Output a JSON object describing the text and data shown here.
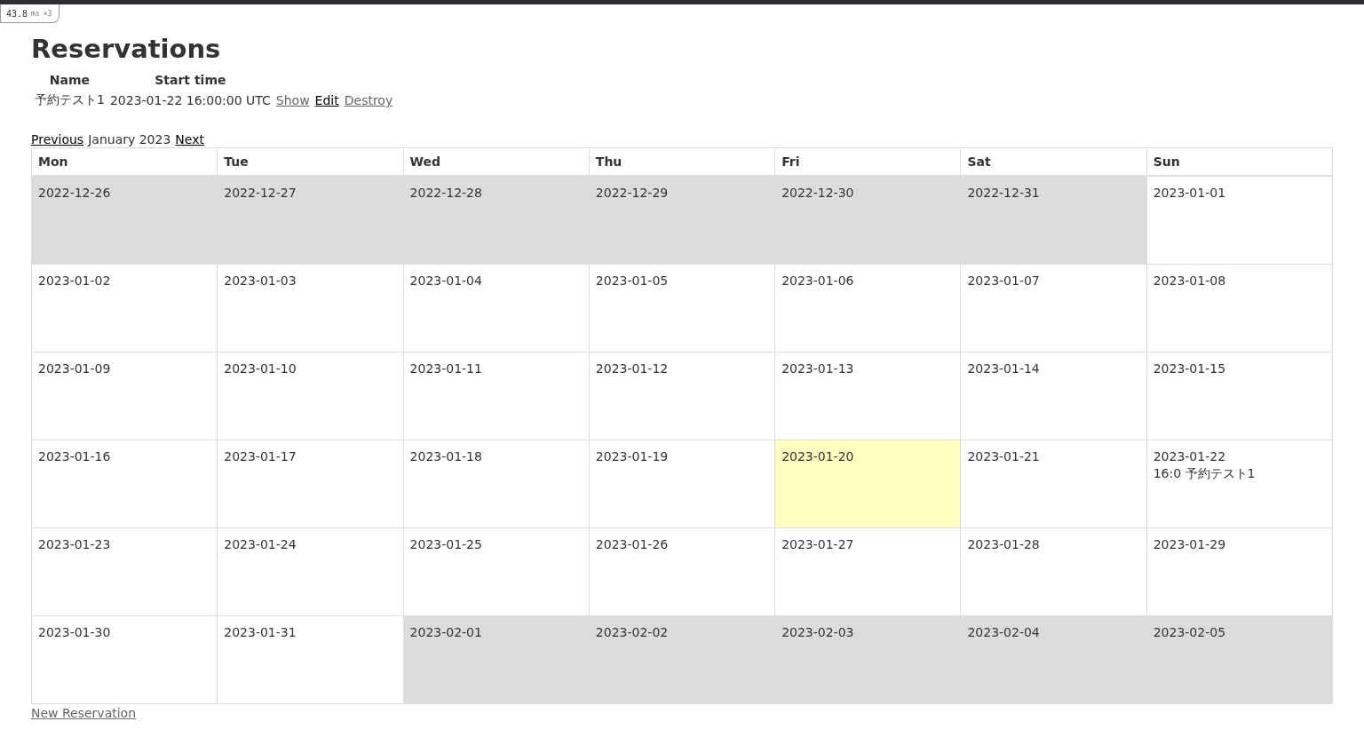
{
  "profiler": {
    "time": "43.8",
    "unit": "ms",
    "count": "×3"
  },
  "title": "Reservations",
  "reservations": {
    "columns": [
      "Name",
      "Start time"
    ],
    "rows": [
      {
        "name": "予約テスト1",
        "start_time": "2023-01-22 16:00:00 UTC",
        "links": [
          {
            "label": "Show",
            "visited": true
          },
          {
            "label": "Edit",
            "visited": false
          },
          {
            "label": "Destroy",
            "visited": true
          }
        ]
      }
    ]
  },
  "calendar": {
    "previous": "Previous",
    "month": "January 2023",
    "next": "Next",
    "weekdays": [
      "Mon",
      "Tue",
      "Wed",
      "Thu",
      "Fri",
      "Sat",
      "Sun"
    ],
    "weeks": [
      [
        {
          "date": "2022-12-26",
          "kind": "other"
        },
        {
          "date": "2022-12-27",
          "kind": "other"
        },
        {
          "date": "2022-12-28",
          "kind": "other"
        },
        {
          "date": "2022-12-29",
          "kind": "other"
        },
        {
          "date": "2022-12-30",
          "kind": "other"
        },
        {
          "date": "2022-12-31",
          "kind": "other"
        },
        {
          "date": "2023-01-01",
          "kind": "current"
        }
      ],
      [
        {
          "date": "2023-01-02",
          "kind": "current"
        },
        {
          "date": "2023-01-03",
          "kind": "current"
        },
        {
          "date": "2023-01-04",
          "kind": "current"
        },
        {
          "date": "2023-01-05",
          "kind": "current"
        },
        {
          "date": "2023-01-06",
          "kind": "current"
        },
        {
          "date": "2023-01-07",
          "kind": "current"
        },
        {
          "date": "2023-01-08",
          "kind": "current"
        }
      ],
      [
        {
          "date": "2023-01-09",
          "kind": "current"
        },
        {
          "date": "2023-01-10",
          "kind": "current"
        },
        {
          "date": "2023-01-11",
          "kind": "current"
        },
        {
          "date": "2023-01-12",
          "kind": "current"
        },
        {
          "date": "2023-01-13",
          "kind": "current"
        },
        {
          "date": "2023-01-14",
          "kind": "current"
        },
        {
          "date": "2023-01-15",
          "kind": "current"
        }
      ],
      [
        {
          "date": "2023-01-16",
          "kind": "current"
        },
        {
          "date": "2023-01-17",
          "kind": "current"
        },
        {
          "date": "2023-01-18",
          "kind": "current"
        },
        {
          "date": "2023-01-19",
          "kind": "current"
        },
        {
          "date": "2023-01-20",
          "kind": "today"
        },
        {
          "date": "2023-01-21",
          "kind": "current"
        },
        {
          "date": "2023-01-22",
          "kind": "current",
          "events": [
            "16:0 予約テスト1"
          ]
        }
      ],
      [
        {
          "date": "2023-01-23",
          "kind": "current"
        },
        {
          "date": "2023-01-24",
          "kind": "current"
        },
        {
          "date": "2023-01-25",
          "kind": "current"
        },
        {
          "date": "2023-01-26",
          "kind": "current"
        },
        {
          "date": "2023-01-27",
          "kind": "current"
        },
        {
          "date": "2023-01-28",
          "kind": "current"
        },
        {
          "date": "2023-01-29",
          "kind": "current"
        }
      ],
      [
        {
          "date": "2023-01-30",
          "kind": "current"
        },
        {
          "date": "2023-01-31",
          "kind": "current"
        },
        {
          "date": "2023-02-01",
          "kind": "other"
        },
        {
          "date": "2023-02-02",
          "kind": "other"
        },
        {
          "date": "2023-02-03",
          "kind": "other"
        },
        {
          "date": "2023-02-04",
          "kind": "other"
        },
        {
          "date": "2023-02-05",
          "kind": "other"
        }
      ]
    ]
  },
  "new_link": "New Reservation"
}
